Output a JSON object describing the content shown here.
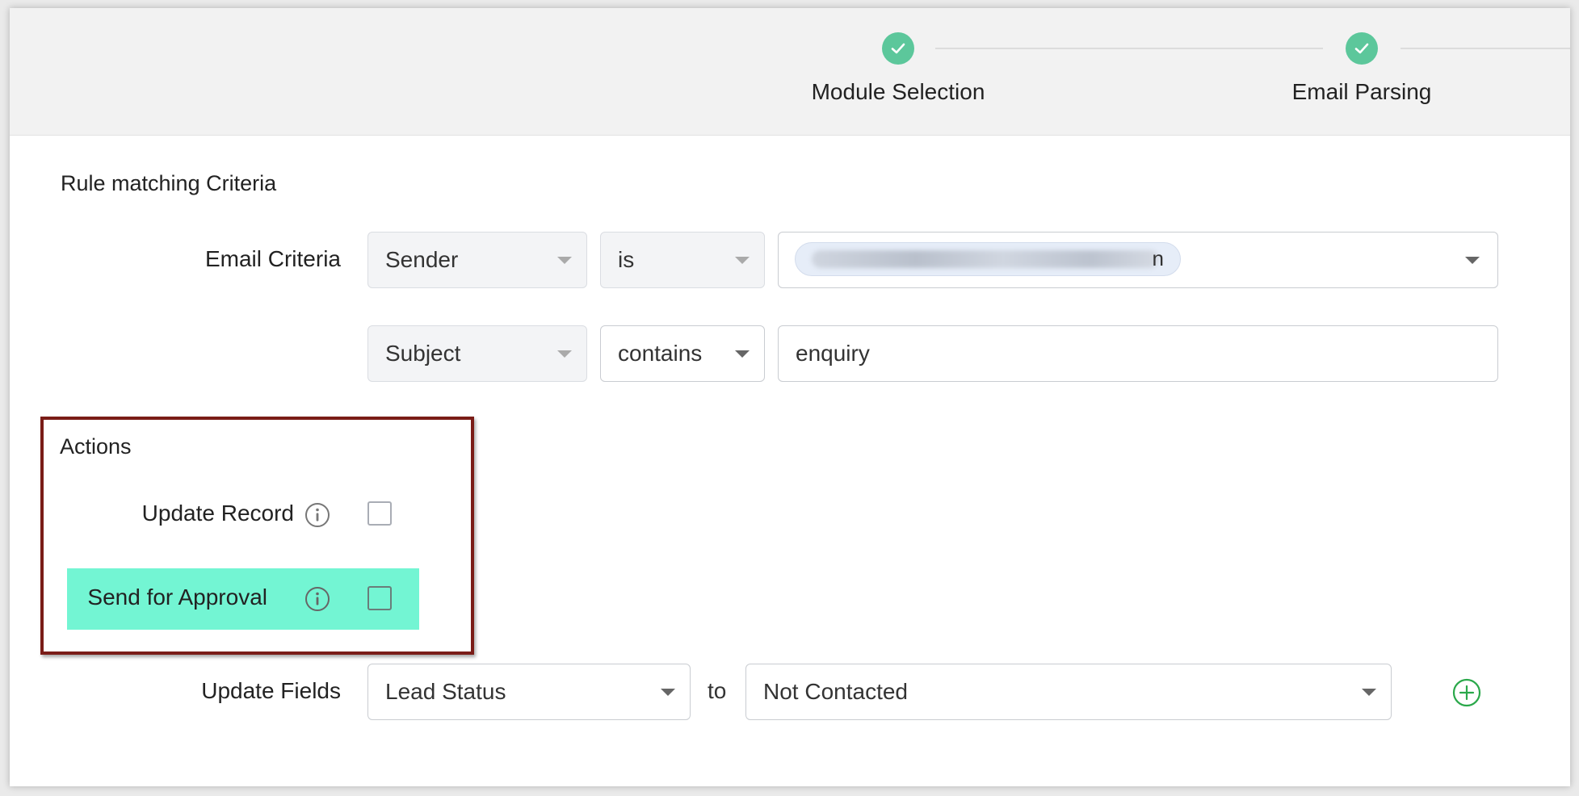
{
  "stepper": {
    "steps": [
      {
        "label": "Module Selection",
        "status": "completed"
      },
      {
        "label": "Email Parsing",
        "status": "completed"
      }
    ],
    "completed_color": "#5cc79b"
  },
  "rule_section": {
    "title": "Rule matching Criteria",
    "email_criteria_label": "Email Criteria",
    "criteria": [
      {
        "field": "Sender",
        "operator": "is",
        "value": "n",
        "value_redacted": true
      },
      {
        "field": "Subject",
        "operator": "contains",
        "value": "enquiry"
      }
    ]
  },
  "actions": {
    "title": "Actions",
    "update_record_label": "Update Record",
    "update_record_checked": false,
    "send_for_approval_label": "Send for Approval",
    "send_for_approval_checked": false,
    "highlight_color": "#73f5d3",
    "annotation_box_color": "#7a1c17"
  },
  "update_fields": {
    "label": "Update Fields",
    "field": "Lead Status",
    "connector": "to",
    "value": "Not Contacted"
  },
  "icons": {
    "step_check": "check-icon",
    "info": "info-icon",
    "caret": "caret-down-icon",
    "add": "plus-circle-icon",
    "add_color": "#2aa84a"
  }
}
